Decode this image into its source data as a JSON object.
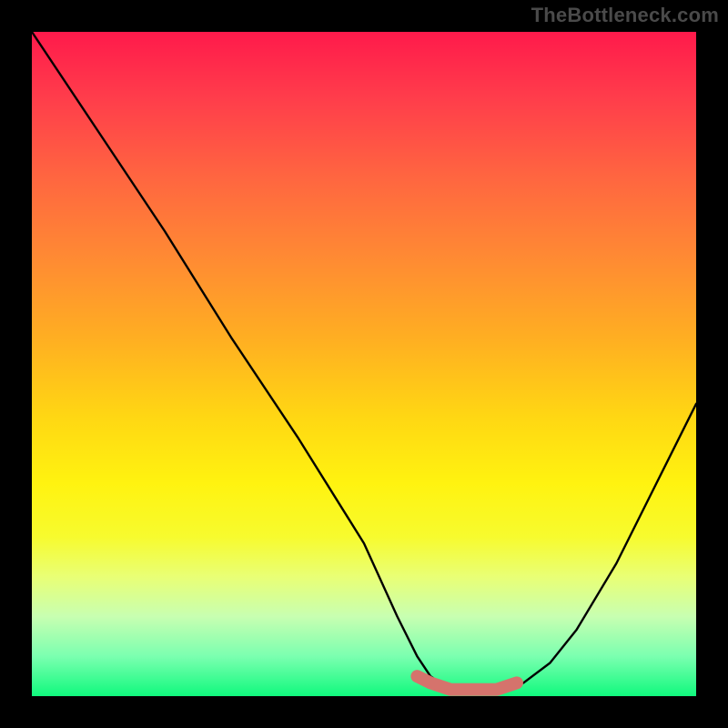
{
  "watermark": "TheBottleneck.com",
  "chart_data": {
    "type": "line",
    "title": "",
    "xlabel": "",
    "ylabel": "",
    "xlim": [
      0,
      100
    ],
    "ylim": [
      0,
      100
    ],
    "series": [
      {
        "name": "bottleneck-curve",
        "x": [
          0,
          10,
          20,
          30,
          40,
          50,
          55,
          58,
          60,
          63,
          66,
          70,
          74,
          78,
          82,
          88,
          94,
          100
        ],
        "values": [
          100,
          85,
          70,
          54,
          39,
          23,
          12,
          6,
          3,
          1,
          1,
          1,
          2,
          5,
          10,
          20,
          32,
          44
        ]
      },
      {
        "name": "optimal-range-marker",
        "x": [
          58,
          60,
          63,
          66,
          70,
          73
        ],
        "values": [
          3,
          2,
          1,
          1,
          1,
          2
        ]
      }
    ],
    "gradient_stops": [
      {
        "pos": 0,
        "color": "#ff1a4b"
      },
      {
        "pos": 10,
        "color": "#ff3d4b"
      },
      {
        "pos": 22,
        "color": "#ff6640"
      },
      {
        "pos": 34,
        "color": "#ff8a33"
      },
      {
        "pos": 46,
        "color": "#ffae22"
      },
      {
        "pos": 58,
        "color": "#ffd713"
      },
      {
        "pos": 68,
        "color": "#fff310"
      },
      {
        "pos": 76,
        "color": "#f7fb2e"
      },
      {
        "pos": 82,
        "color": "#e9ff75"
      },
      {
        "pos": 88,
        "color": "#c8ffb1"
      },
      {
        "pos": 94,
        "color": "#7bffb0"
      },
      {
        "pos": 100,
        "color": "#10f97d"
      }
    ],
    "colors": {
      "curve": "#000000",
      "marker": "#d5736c",
      "background_frame": "#000000"
    }
  }
}
